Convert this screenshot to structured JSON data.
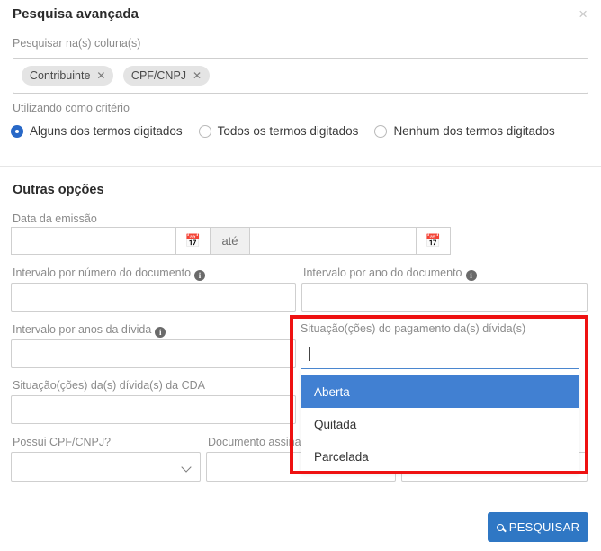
{
  "dialog": {
    "title": "Pesquisa avançada",
    "close_label": "×"
  },
  "columns": {
    "label": "Pesquisar na(s) coluna(s)",
    "chips": [
      {
        "label": "Contribuinte",
        "remove": "✕"
      },
      {
        "label": "CPF/CNPJ",
        "remove": "✕"
      }
    ]
  },
  "criteria": {
    "label": "Utilizando como critério",
    "options": [
      {
        "label": "Alguns dos termos digitados",
        "selected": true
      },
      {
        "label": "Todos os termos digitados",
        "selected": false
      },
      {
        "label": "Nenhum dos termos digitados",
        "selected": false
      }
    ]
  },
  "other_options": {
    "section_title": "Outras opções",
    "issue_date": {
      "label": "Data da emissão",
      "from_value": "",
      "from_placeholder": "",
      "separator": "até",
      "to_value": "",
      "to_placeholder": "",
      "calendar_icon": "calendar-icon"
    },
    "doc_number_range": {
      "label": "Intervalo por número do documento",
      "info": "i",
      "value": ""
    },
    "doc_year_range": {
      "label": "Intervalo por ano do documento",
      "info": "i",
      "value": ""
    },
    "debt_years_range": {
      "label": "Intervalo por anos da dívida",
      "info": "i",
      "value": ""
    },
    "cda_debt_status": {
      "label": "Situação(ções) da(s) dívida(s) da CDA",
      "value": ""
    },
    "payment_status": {
      "label": "Situação(ções) do pagamento da(s) dívida(s)",
      "search_value": "",
      "options": [
        {
          "label": "Aberta",
          "highlighted": true
        },
        {
          "label": "Quitada",
          "highlighted": false
        },
        {
          "label": "Parcelada",
          "highlighted": false
        }
      ]
    },
    "has_cpf_cnpj": {
      "label": "Possui CPF/CNPJ?",
      "value": "",
      "caret": "chevron-down-icon"
    },
    "signed_document": {
      "label": "Documento assinado",
      "value": ""
    },
    "extra_field": {
      "value": ""
    }
  },
  "actions": {
    "search_label": "PESQUISAR",
    "search_icon": "search-icon"
  },
  "colors": {
    "accent_blue": "#2f77c4",
    "highlight_blue": "#4180d2",
    "focus_blue": "#4a86cf",
    "annotation_red": "#ee1111",
    "chip_gray": "#e4e4e4"
  }
}
